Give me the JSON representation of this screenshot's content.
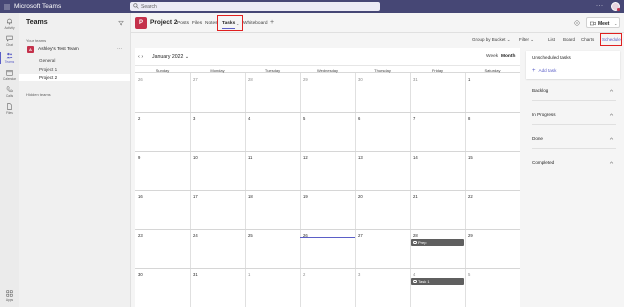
{
  "titlebar": {
    "app_name": "Microsoft Teams",
    "search_placeholder": "Search",
    "more": "···"
  },
  "appbar": [
    {
      "label": "Activity",
      "icon": "bell-icon"
    },
    {
      "label": "Chat",
      "icon": "chat-icon"
    },
    {
      "label": "Teams",
      "icon": "teams-icon",
      "active": true
    },
    {
      "label": "Calendar",
      "icon": "calendar-icon"
    },
    {
      "label": "Calls",
      "icon": "phone-icon"
    },
    {
      "label": "Files",
      "icon": "file-icon"
    },
    {
      "label": "Apps",
      "icon": "apps-icon"
    }
  ],
  "teams_panel": {
    "title": "Teams",
    "your_teams": "Your teams",
    "team": {
      "name": "Ashley's Test Team",
      "avatar": "A",
      "more": "···"
    },
    "channels": [
      "General",
      "Project 1",
      "Project 2"
    ],
    "selected_channel": "Project 2",
    "hidden_teams": "Hidden teams"
  },
  "channel_header": {
    "avatar": "P",
    "name": "Project 2",
    "tabs": [
      "Posts",
      "Files",
      "Notes",
      "Tasks",
      "Whiteboard"
    ],
    "active_tab": "Tasks",
    "tab_chevron": "⌄",
    "add_tab": "+",
    "meet": {
      "label": "Meet",
      "chevron": "⌄"
    }
  },
  "toolbar": {
    "group_by": "Group by Bucket ⌄",
    "filter": "Filter ⌄",
    "views": [
      "List",
      "Board",
      "Charts",
      "Schedule"
    ],
    "active_view": "Schedule"
  },
  "calendar": {
    "nav": "‹ ›",
    "month": "January 2022 ⌄",
    "week": "Week",
    "month_btn": "Month",
    "weekdays": [
      "Sunday",
      "Monday",
      "Tuesday",
      "Wednesday",
      "Thursday",
      "Friday",
      "Saturday"
    ],
    "weeks": [
      [
        "26",
        "27",
        "28",
        "29",
        "30",
        "31",
        "1"
      ],
      [
        "2",
        "3",
        "4",
        "5",
        "6",
        "7",
        "8"
      ],
      [
        "9",
        "10",
        "11",
        "12",
        "13",
        "14",
        "15"
      ],
      [
        "16",
        "17",
        "18",
        "19",
        "20",
        "21",
        "22"
      ],
      [
        "23",
        "24",
        "25",
        "26",
        "27",
        "28",
        "29"
      ],
      [
        "30",
        "31",
        "1",
        "2",
        "3",
        "4",
        "5"
      ]
    ],
    "tasks": [
      {
        "name": "Prep",
        "week": 4,
        "day": 5
      },
      {
        "name": "Task 1",
        "week": 5,
        "day": 5
      }
    ]
  },
  "right_panel": {
    "unscheduled": "Unscheduled tasks",
    "add_task": "Add task",
    "add_icon": "+",
    "buckets": [
      "Backlog",
      "In Progress",
      "Done",
      "Completed"
    ]
  },
  "colors": {
    "titlebar": "#464775",
    "accent": "#5b5fc7",
    "team_red": "#c4314b",
    "highlight_box": "#e02020",
    "task_bar": "#5f5f5f"
  }
}
